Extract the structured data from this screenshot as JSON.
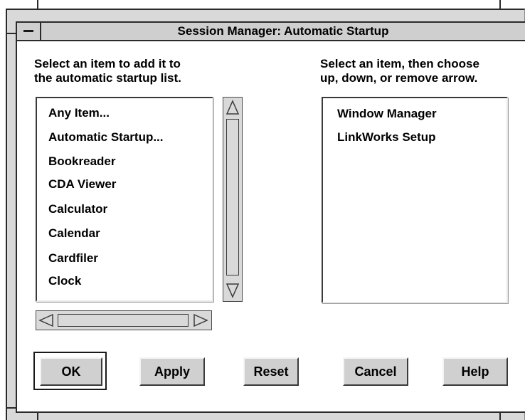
{
  "window": {
    "title": "Session Manager: Automatic Startup"
  },
  "available": {
    "instruction_line1": "Select an item to add it to",
    "instruction_line2": "the automatic startup list.",
    "items": [
      "Any Item...",
      "Automatic Startup...",
      "Bookreader",
      "CDA Viewer",
      "Calculator",
      "Calendar",
      "Cardfiler",
      "Clock"
    ]
  },
  "startup": {
    "instruction_line1": "Select an item, then choose",
    "instruction_line2": "up, down, or remove arrow.",
    "items": [
      "Window Manager",
      "LinkWorks Setup"
    ]
  },
  "buttons": {
    "ok": "OK",
    "apply": "Apply",
    "reset": "Reset",
    "cancel": "Cancel",
    "help": "Help"
  },
  "icons": {
    "window_menu": "window-menu-icon",
    "scroll_up": "triangle-up-icon",
    "scroll_down": "triangle-down-icon",
    "scroll_left": "triangle-left-icon",
    "scroll_right": "triangle-right-icon"
  },
  "colors": {
    "background": "#d9d9d9",
    "list_background": "#ffffff",
    "text": "#000000"
  }
}
